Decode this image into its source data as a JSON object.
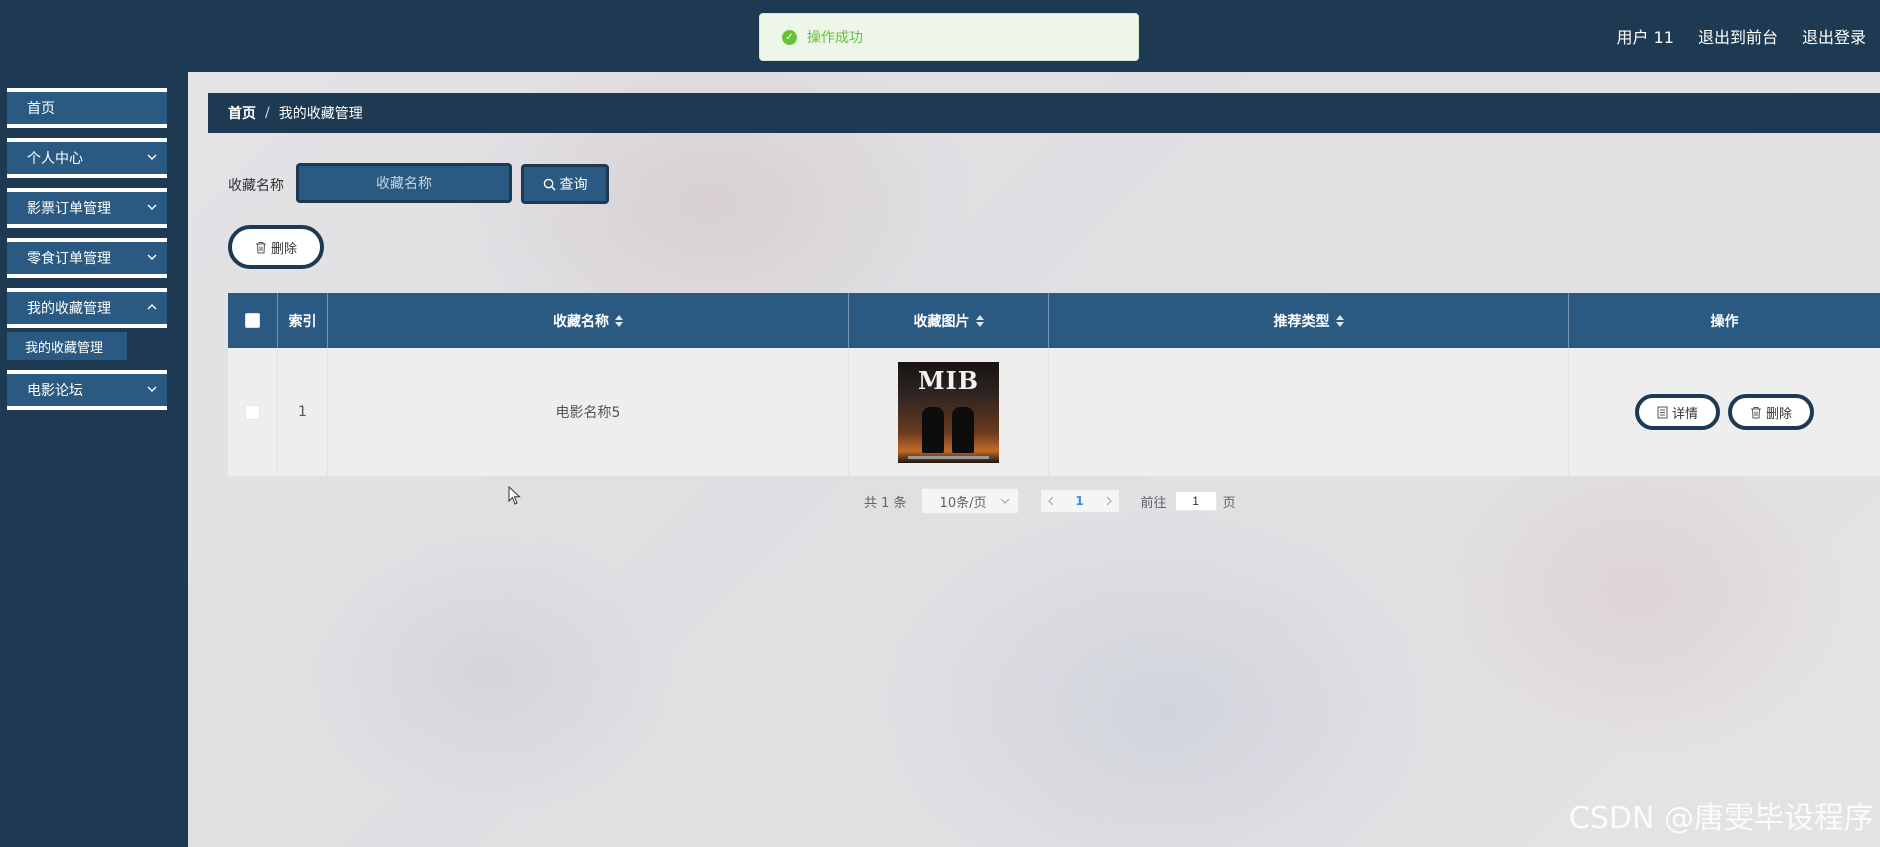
{
  "header": {
    "user_label": "用户 11",
    "to_front": "退出到前台",
    "logout": "退出登录"
  },
  "toast": {
    "message": "操作成功",
    "color": "#67c23a"
  },
  "sidebar": {
    "items": [
      {
        "label": "首页"
      },
      {
        "label": "个人中心"
      },
      {
        "label": "影票订单管理"
      },
      {
        "label": "零食订单管理"
      },
      {
        "label": "我的收藏管理"
      },
      {
        "label": "电影论坛"
      }
    ],
    "subitem": "我的收藏管理"
  },
  "breadcrumb": {
    "home": "首页",
    "sep": "/",
    "current": "我的收藏管理"
  },
  "search": {
    "label": "收藏名称",
    "placeholder": "收藏名称",
    "button": "查询"
  },
  "toolbar": {
    "delete": "删除"
  },
  "table": {
    "columns": [
      "索引",
      "收藏名称",
      "收藏图片",
      "推荐类型",
      "操作"
    ],
    "rows": [
      {
        "index": "1",
        "name": "电影名称5",
        "image_title": "MIB",
        "type": "",
        "detail": "详情",
        "delete": "删除"
      }
    ]
  },
  "pagination": {
    "total": "共 1 条",
    "page_size": "10条/页",
    "current_page": "1",
    "goto_label": "前往",
    "goto_value": "1",
    "page_suffix": "页"
  },
  "watermark": "CSDN @唐雯毕设程序",
  "colors": {
    "nav_dark": "#1e3a52",
    "nav_item": "#2a5a82",
    "success": "#67c23a"
  }
}
